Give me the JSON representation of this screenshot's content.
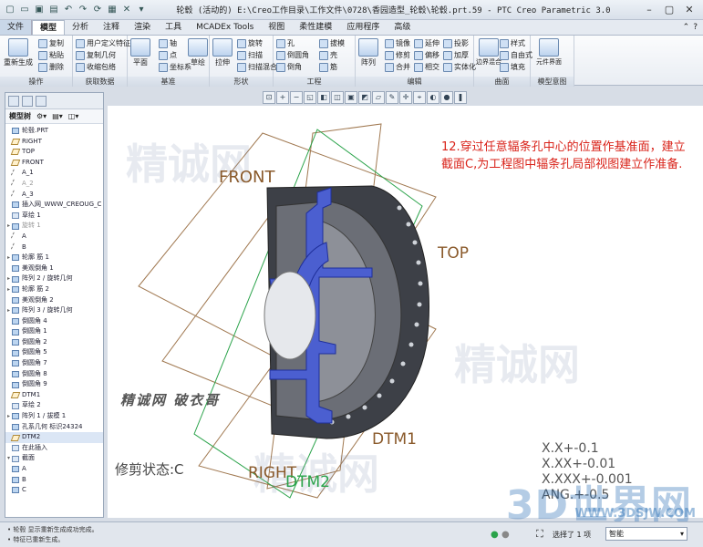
{
  "window": {
    "title": "轮毂 (活动的) E:\\Creo工作目录\\工作文件\\0728\\香园造型_轮毂\\轮毂.prt.59 - PTC Creo Parametric 3.0"
  },
  "menubar": {
    "items": [
      "文件",
      "模型",
      "分析",
      "注释",
      "渲染",
      "工具",
      "MCADEx Tools",
      "视图",
      "柔性建模",
      "应用程序",
      "高级"
    ],
    "active_index": 1
  },
  "ribbon": {
    "groups": [
      {
        "label": "操作",
        "buttons": [
          "重新生成",
          "复制",
          "粘贴",
          "删除"
        ]
      },
      {
        "label": "获取数据",
        "buttons": [
          "用户定义特征",
          "复制几何",
          "收缩包络"
        ]
      },
      {
        "label": "基准",
        "buttons": [
          "平面",
          "轴",
          "点",
          "坐标系",
          "草绘"
        ]
      },
      {
        "label": "形状",
        "buttons": [
          "拉伸",
          "旋转",
          "扫描",
          "扫描混合"
        ]
      },
      {
        "label": "工程",
        "buttons": [
          "孔",
          "倒圆角",
          "倒角",
          "拔模",
          "壳",
          "筋"
        ]
      },
      {
        "label": "编辑",
        "buttons": [
          "阵列",
          "镜像",
          "修剪",
          "合并",
          "延伸",
          "偏移",
          "相交",
          "投影",
          "加厚",
          "实体化"
        ]
      },
      {
        "label": "曲面",
        "buttons": [
          "边界混合",
          "样式",
          "自由式",
          "填充"
        ]
      },
      {
        "label": "模型意图",
        "buttons": [
          "元件界面"
        ]
      }
    ]
  },
  "model_tree": {
    "header": "模型树",
    "items": [
      {
        "label": "轮毂.PRT",
        "icon": "part-icon",
        "expand": ""
      },
      {
        "label": "RIGHT",
        "icon": "plane-icon",
        "expand": ""
      },
      {
        "label": "TOP",
        "icon": "plane-icon",
        "expand": ""
      },
      {
        "label": "FRONT",
        "icon": "plane-icon",
        "expand": ""
      },
      {
        "label": "A_1",
        "icon": "axis-icon",
        "expand": ""
      },
      {
        "label": "A_2",
        "icon": "axis-icon",
        "expand": "",
        "dim": true
      },
      {
        "label": "A_3",
        "icon": "axis-icon",
        "expand": ""
      },
      {
        "label": "插入网_WWW_CREOUG_C",
        "icon": "feature-icon",
        "expand": ""
      },
      {
        "label": "草绘 1",
        "icon": "sketch-icon",
        "expand": ""
      },
      {
        "label": "旋转 1",
        "icon": "feature-icon",
        "expand": "▸",
        "dim": true
      },
      {
        "label": "A",
        "icon": "axis-icon",
        "expand": ""
      },
      {
        "label": "B",
        "icon": "axis-icon",
        "expand": ""
      },
      {
        "label": "轮廓 筋 1",
        "icon": "feature-icon",
        "expand": "▸"
      },
      {
        "label": "美观倒角 1",
        "icon": "feature-icon",
        "expand": ""
      },
      {
        "label": "阵列 2 / 旋转几何",
        "icon": "feature-icon",
        "expand": "▸"
      },
      {
        "label": "轮廓 筋 2",
        "icon": "feature-icon",
        "expand": "▸"
      },
      {
        "label": "美观倒角 2",
        "icon": "feature-icon",
        "expand": ""
      },
      {
        "label": "阵列 3 / 旋转几何",
        "icon": "feature-icon",
        "expand": "▸"
      },
      {
        "label": "倒圆角 4",
        "icon": "feature-icon",
        "expand": ""
      },
      {
        "label": "倒圆角 1",
        "icon": "feature-icon",
        "expand": ""
      },
      {
        "label": "倒圆角 2",
        "icon": "feature-icon",
        "expand": ""
      },
      {
        "label": "倒圆角 5",
        "icon": "feature-icon",
        "expand": ""
      },
      {
        "label": "倒圆角 7",
        "icon": "feature-icon",
        "expand": ""
      },
      {
        "label": "倒圆角 8",
        "icon": "feature-icon",
        "expand": ""
      },
      {
        "label": "倒圆角 9",
        "icon": "feature-icon",
        "expand": ""
      },
      {
        "label": "DTM1",
        "icon": "plane-icon",
        "expand": ""
      },
      {
        "label": "草绘 2",
        "icon": "sketch-icon",
        "expand": ""
      },
      {
        "label": "阵列 1 / 拔模 1",
        "icon": "feature-icon",
        "expand": "▸"
      },
      {
        "label": "孔系几何 标识24324",
        "icon": "feature-icon",
        "expand": ""
      },
      {
        "label": "DTM2",
        "icon": "plane-icon",
        "expand": "",
        "selected": true
      },
      {
        "label": "在此插入",
        "icon": "insert-icon",
        "expand": ""
      },
      {
        "label": "截面",
        "icon": "folder-icon",
        "expand": "▾"
      },
      {
        "label": "A",
        "icon": "section-icon",
        "expand": ""
      },
      {
        "label": "B",
        "icon": "section-icon",
        "expand": ""
      },
      {
        "label": "C",
        "icon": "section-icon",
        "expand": ""
      }
    ]
  },
  "viewport": {
    "note": "12.穿过任意辐条孔中心的位置作基准面，建立截面C,为工程图中辐条孔局部视图建立作准备.",
    "planes": {
      "front": "FRONT",
      "top": "TOP",
      "right": "RIGHT",
      "dtm1": "DTM1",
      "dtm2": "DTM2"
    },
    "trim_state": "修剪状态:C",
    "tolerances": [
      "X.X+-0.1",
      "X.XX+-0.01",
      "X.XXX+-0.001",
      "ANG.+-0.5"
    ],
    "watermark_text": "精诚网  破衣哥",
    "watermark_logo": "3D世界网",
    "watermark_url": "WWW.3DSJW.COM"
  },
  "status": {
    "messages": [
      "• 轮毂 显示重新生成成功完成。",
      "• 特征已重新生成。"
    ],
    "selected": "选择了 1 项",
    "filter": "智能"
  },
  "colors": {
    "note": "#d9231a",
    "plane_label": "#8a5a2b",
    "dtm2": "#2aa34a",
    "section_fill": "#4b5fd0",
    "model_dark": "#3d4047"
  }
}
